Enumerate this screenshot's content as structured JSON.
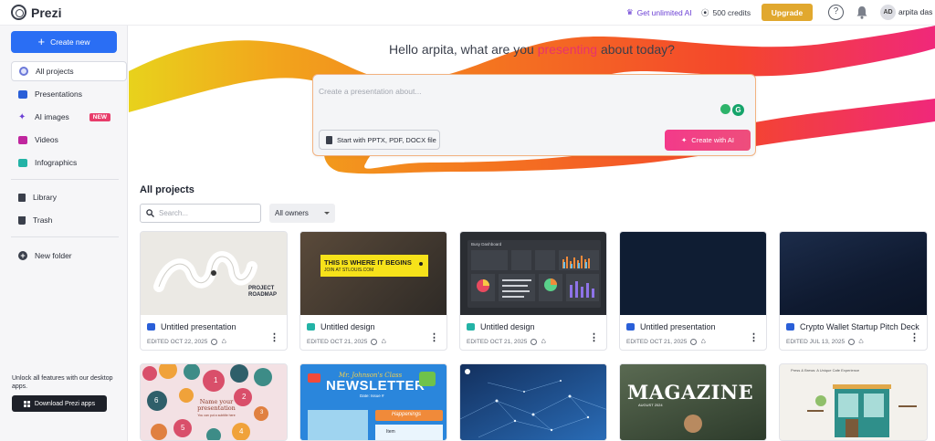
{
  "app": {
    "name": "Prezi"
  },
  "topbar": {
    "ai_link": "Get unlimited AI",
    "credits": "500 credits",
    "upgrade": "Upgrade",
    "help": "?",
    "avatar_initials": "AD",
    "username": "arpita das"
  },
  "sidebar": {
    "create_new": "Create new",
    "items": [
      {
        "label": "All projects",
        "icon": "all-projects-icon",
        "active": true
      },
      {
        "label": "Presentations",
        "icon": "presentations-icon"
      },
      {
        "label": "AI images",
        "icon": "sparkle-icon",
        "badge": "NEW"
      },
      {
        "label": "Videos",
        "icon": "video-icon"
      },
      {
        "label": "Infographics",
        "icon": "infographics-icon"
      },
      {
        "label": "Library",
        "icon": "library-icon"
      },
      {
        "label": "Trash",
        "icon": "trash-icon"
      },
      {
        "label": "New folder",
        "icon": "plus-circle-icon"
      }
    ],
    "unlock_text": "Unlock all features with our desktop apps.",
    "download": "Download Prezi apps"
  },
  "hero": {
    "greeting_pre": "Hello arpita, what are you ",
    "greeting_accent": "presenting",
    "greeting_post": " about today?",
    "prompt_placeholder": "Create a presentation about...",
    "start_with": "Start with PPTX, PDF, DOCX file",
    "create_ai": "Create with AI"
  },
  "projects": {
    "title": "All projects",
    "search_placeholder": "Search...",
    "owner_filter": "All owners",
    "cards": [
      {
        "title": "Untitled presentation",
        "edited": "EDITED OCT 22, 2025",
        "type": "presentation",
        "thumb_text": "PROJECT ROADMAP"
      },
      {
        "title": "Untitled design",
        "edited": "EDITED OCT 21, 2025",
        "type": "design",
        "thumb_text": "THIS IS WHERE IT BEGINS",
        "thumb_sub": "JOIN AT STLOUIS.COM"
      },
      {
        "title": "Untitled design",
        "edited": "EDITED OCT 21, 2025",
        "type": "design",
        "thumb_text": "Busy Dashboard"
      },
      {
        "title": "Untitled presentation",
        "edited": "EDITED OCT 21, 2025",
        "type": "presentation"
      },
      {
        "title": "Crypto Wallet Startup Pitch Deck",
        "edited": "EDITED JUL 13, 2025",
        "type": "presentation"
      }
    ],
    "row2": [
      {
        "thumb_text": "Name your presentation",
        "thumb_sub": "You can put a subtitle here",
        "numbers": [
          "1",
          "2",
          "3",
          "4",
          "5",
          "6"
        ]
      },
      {
        "thumb_text": "NEWSLETTER",
        "thumb_head": "Mr. Johnson's Class",
        "thumb_sub": "Date: Issue #",
        "happenings": "Happenings",
        "item": "Item"
      },
      {
        "thumb_text": ""
      },
      {
        "thumb_text": "MAGAZINE",
        "thumb_sub": "AUGUST 2024"
      },
      {
        "thumb_text": "Press & Brews: A Unique Cafe Experience"
      }
    ]
  },
  "colors": {
    "accent_blue": "#2a6ef4",
    "upgrade": "#e1a82e",
    "ai_pink": "#f33a8a",
    "new_badge": "#e83c6a"
  }
}
